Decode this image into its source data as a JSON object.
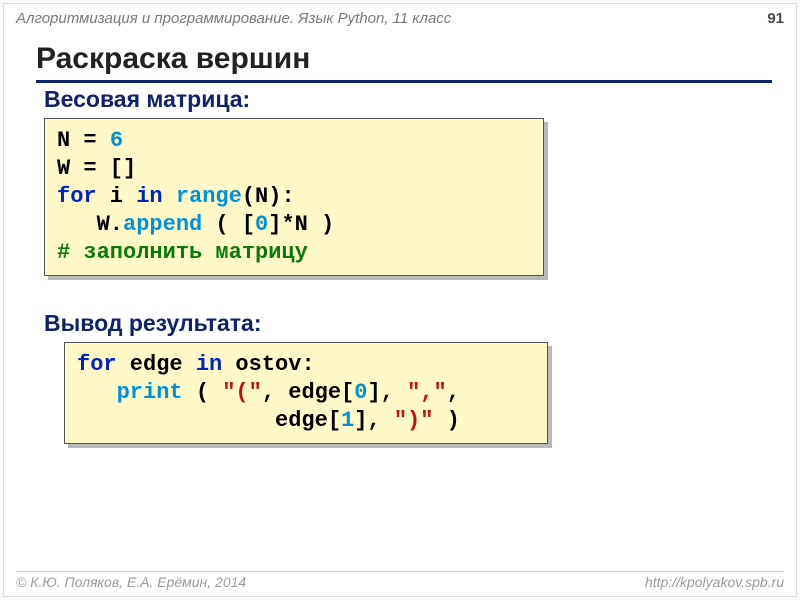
{
  "page_number": "91",
  "course": "Алгоритмизация и программирование. Язык Python, 11 класс",
  "title": "Раскраска вершин",
  "section1": "Весовая матрица:",
  "section2": "Вывод результата:",
  "code1": {
    "t1a": "N = ",
    "t1b": "6",
    "t2": "W = []",
    "t3a": "for",
    "t3b": " i ",
    "t3c": "in",
    "t3d": " ",
    "t3e": "range",
    "t3f": "(N):",
    "t4a": "   W.",
    "t4b": "append",
    "t4c": " ( [",
    "t4d": "0",
    "t4e": "]*N )",
    "t5": "# заполнить матрицу"
  },
  "code2": {
    "t1a": "for",
    "t1b": " edge ",
    "t1c": "in",
    "t1d": " ostov:",
    "t2a": "   ",
    "t2b": "print",
    "t2c": " ( ",
    "t2d": "\"(\"",
    "t2e": ", edge[",
    "t2f": "0",
    "t2g": "], ",
    "t2h": "\",\"",
    "t2i": ",",
    "t3a": "               edge[",
    "t3b": "1",
    "t3c": "], ",
    "t3d": "\")\"",
    "t3e": " )"
  },
  "footer_left": "© К.Ю. Поляков, Е.А. Ерёмин, 2014",
  "footer_right": "http://kpolyakov.spb.ru"
}
